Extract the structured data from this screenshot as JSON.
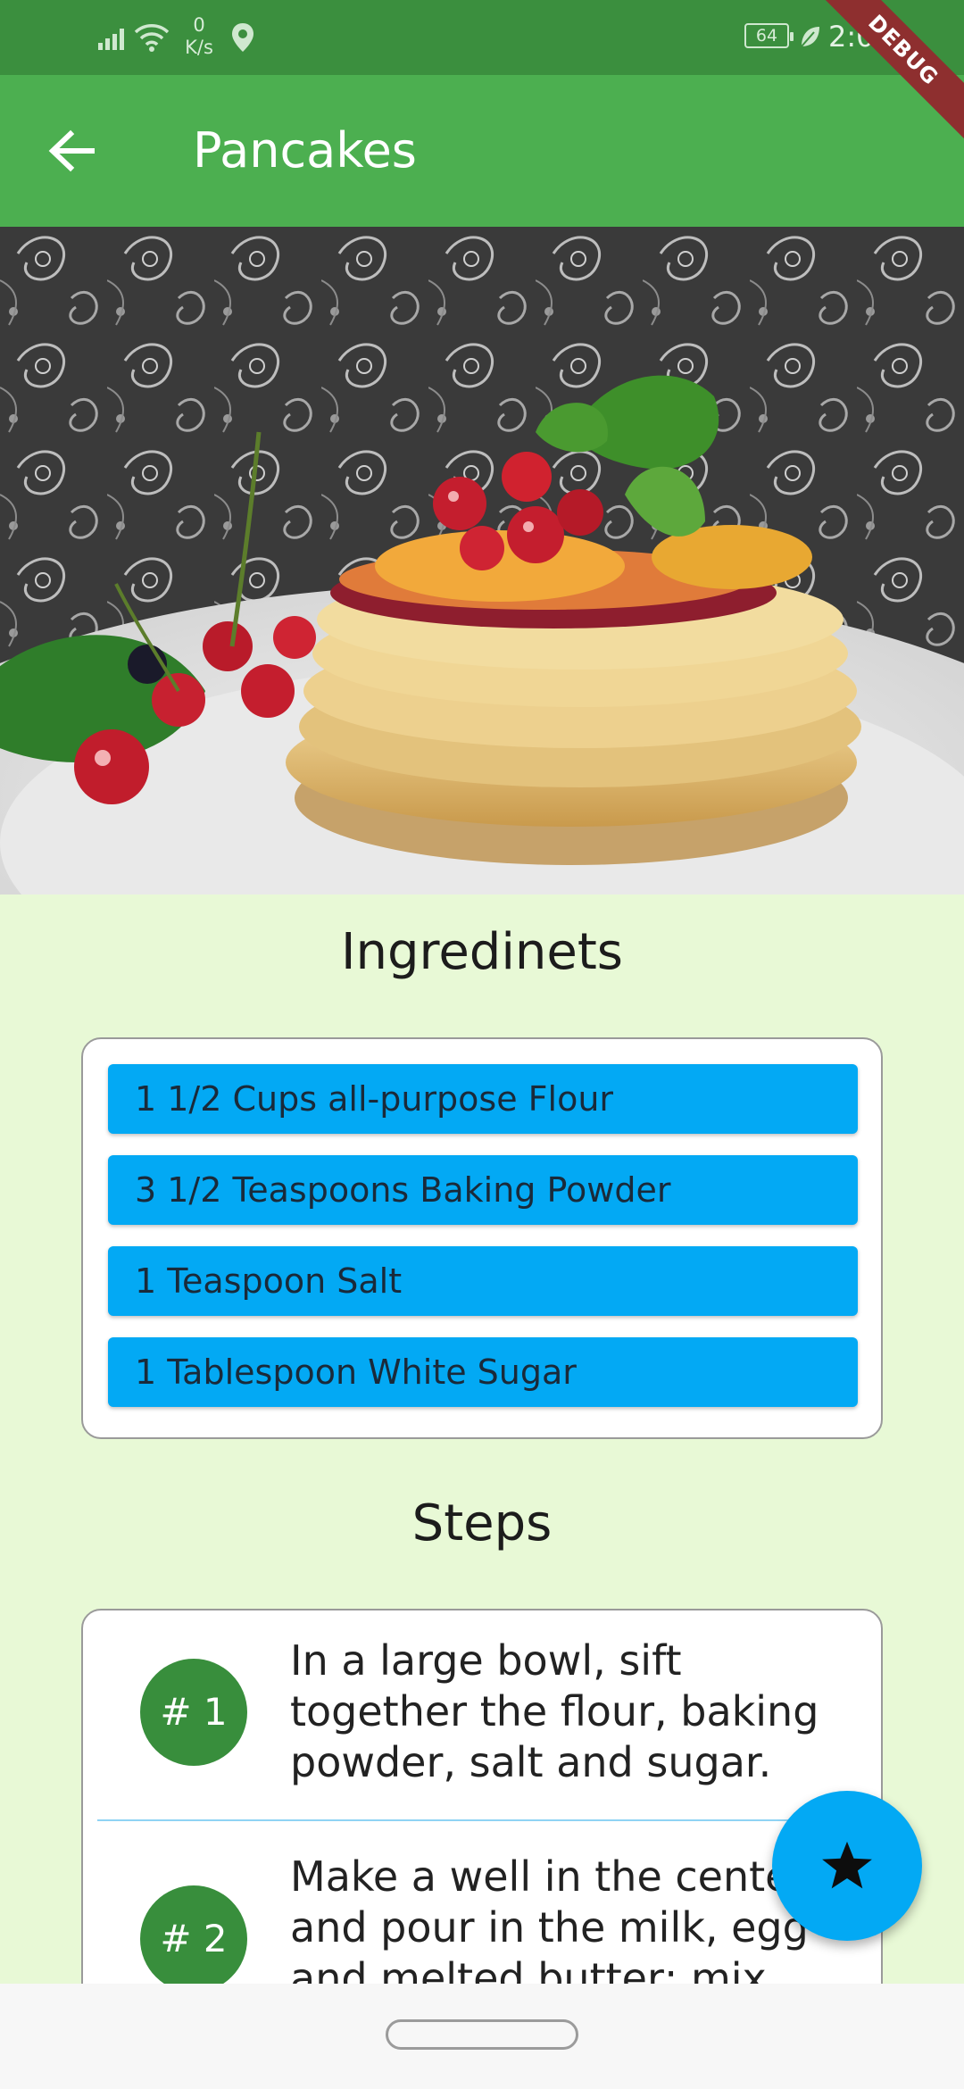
{
  "status_bar": {
    "net_speed_value": "0",
    "net_speed_unit": "K/s",
    "battery": "64",
    "time": "2:0",
    "debug_label": "DEBUG"
  },
  "app_bar": {
    "title": "Pancakes",
    "back_icon": "arrow-back-icon"
  },
  "ingredients": {
    "title": "Ingredinets",
    "items": [
      "1 1/2 Cups all-purpose Flour",
      "3 1/2 Teaspoons Baking Powder",
      "1 Teaspoon Salt",
      "1 Tablespoon White Sugar"
    ]
  },
  "steps": {
    "title": "Steps",
    "items": [
      {
        "badge": "# 1",
        "lines": [
          "In a large bowl, sift",
          "together the flour, baking",
          "powder, salt and sugar."
        ]
      },
      {
        "badge": "# 2",
        "lines": [
          "Make a well in the center",
          "and pour in the milk, egg",
          "and melted butter; mix"
        ]
      }
    ]
  },
  "fab": {
    "icon": "star-icon"
  },
  "colors": {
    "status_bar": "#3b8f3e",
    "app_bar": "#4caf50",
    "background": "#e8f9d6",
    "ingredient_chip": "#03a9f4",
    "step_badge": "#388e3c",
    "fab": "#03a9f4"
  }
}
